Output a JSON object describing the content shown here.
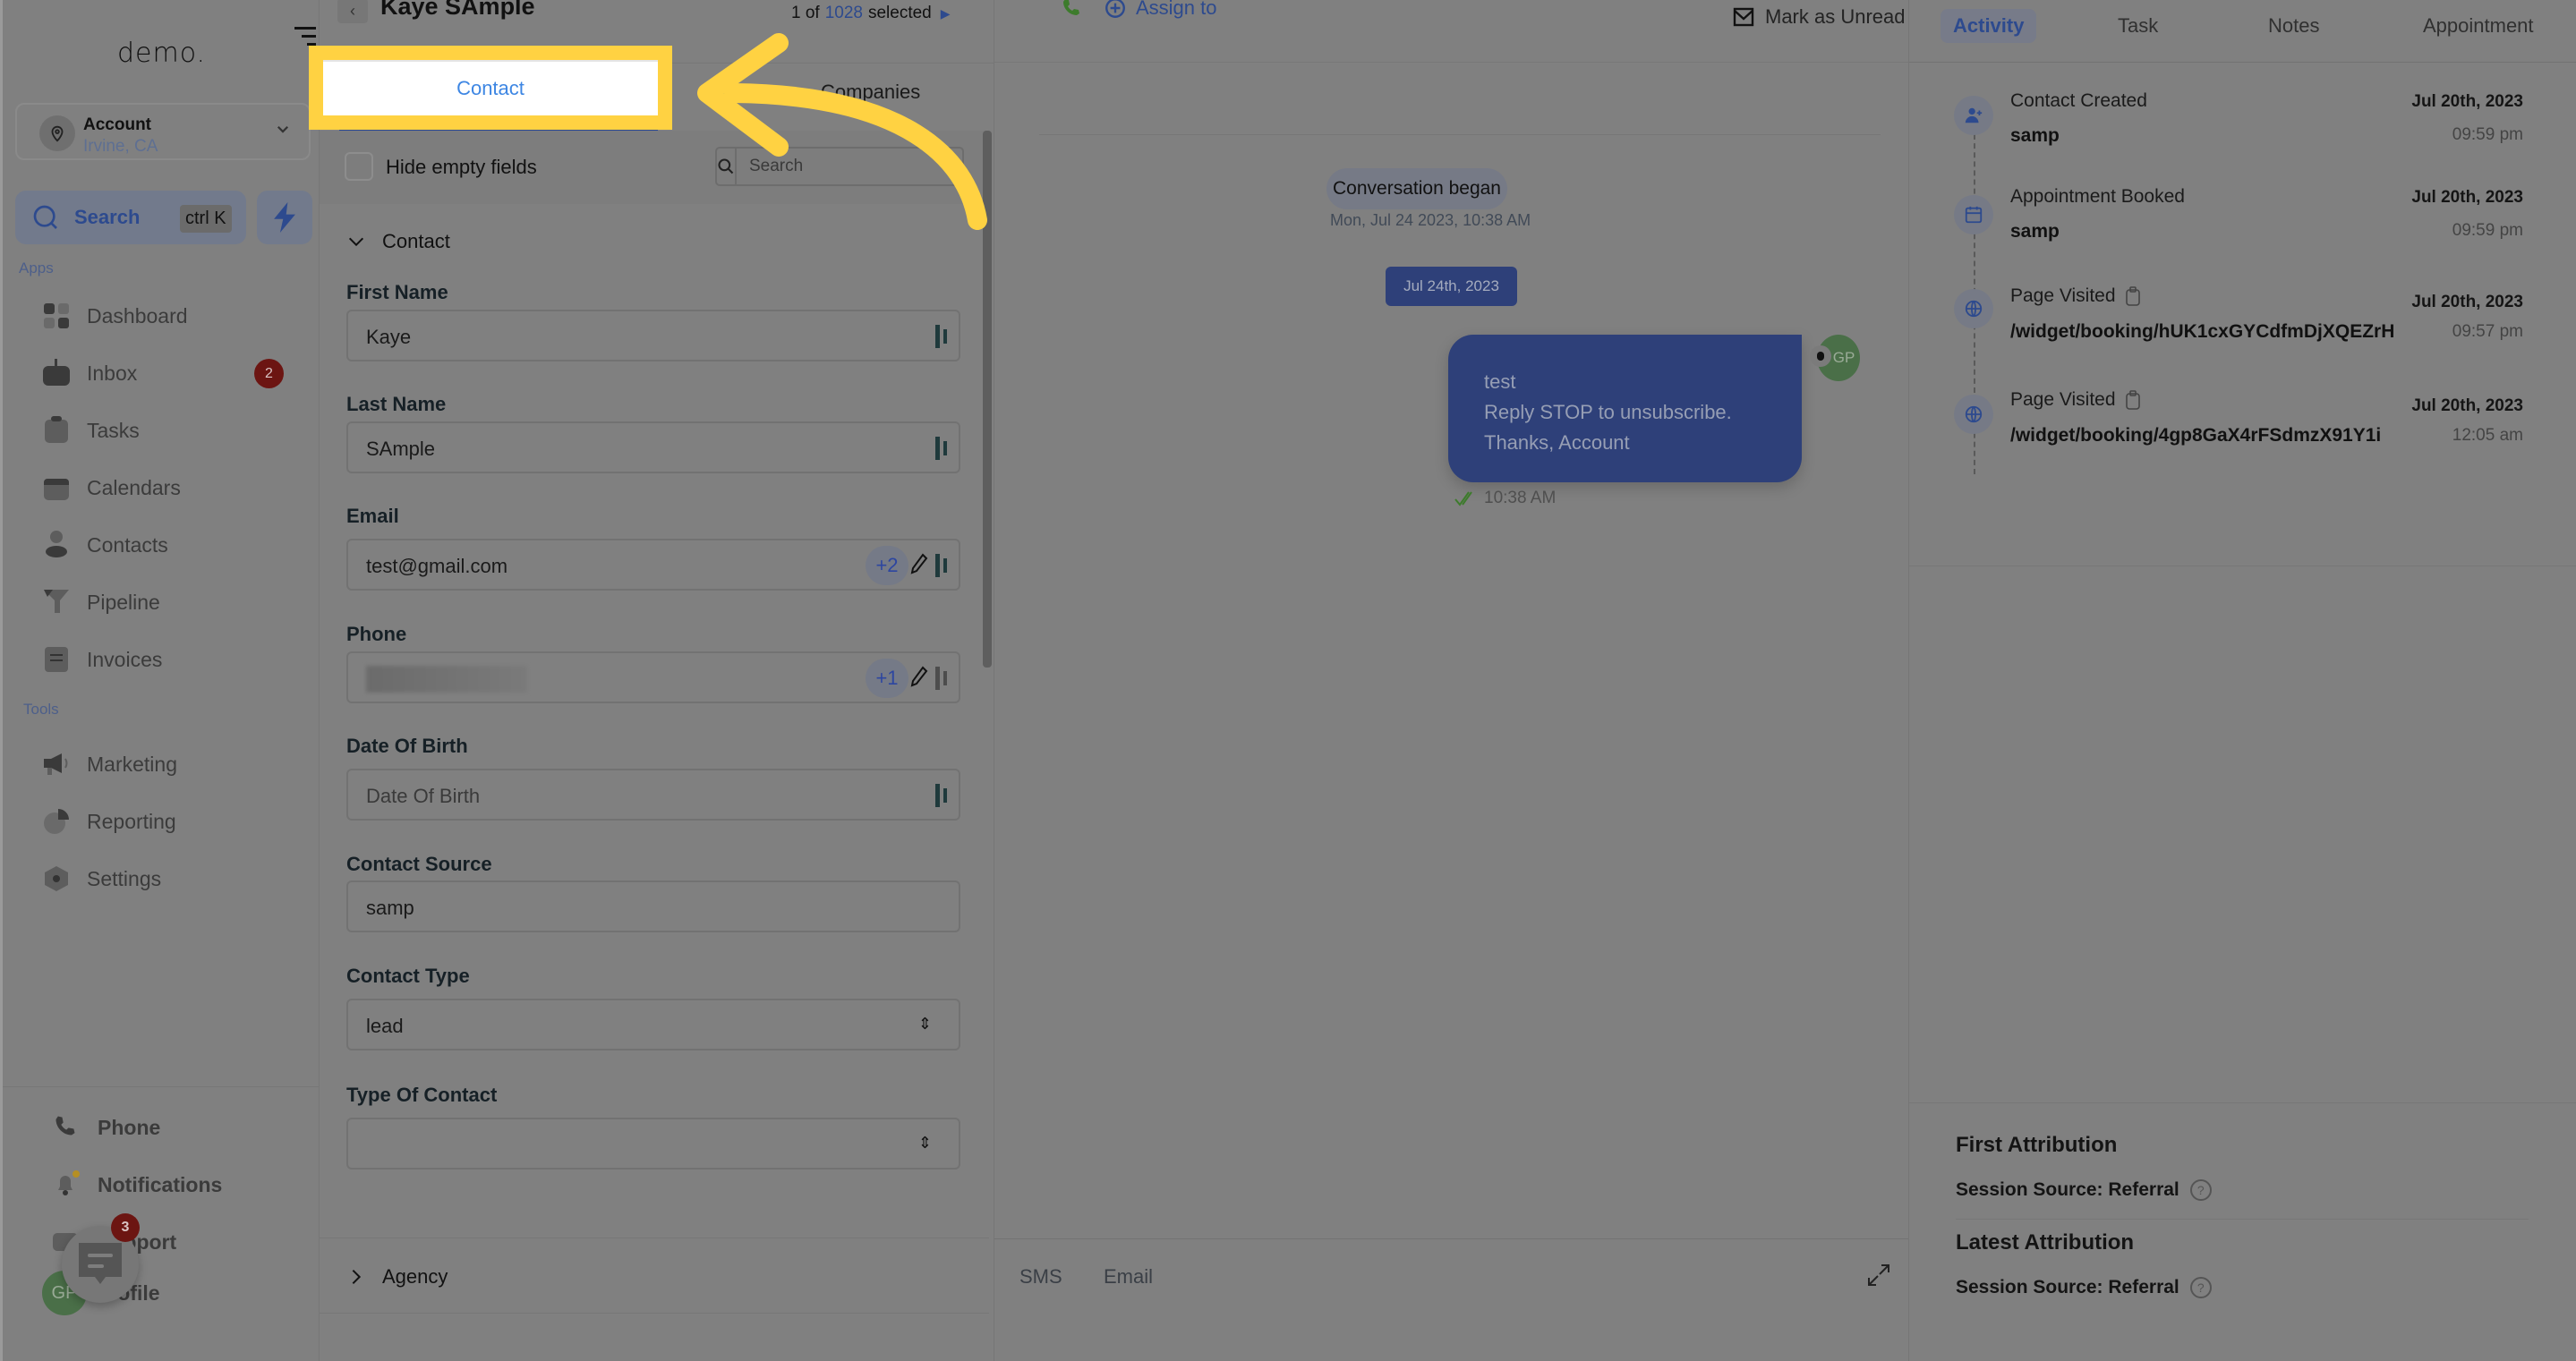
{
  "sidebar": {
    "logo": "demo.",
    "account": {
      "name": "Account",
      "location": "Irvine, CA"
    },
    "search": {
      "label": "Search",
      "shortcut": "ctrl K"
    },
    "apps_label": "Apps",
    "tools_label": "Tools",
    "apps": [
      {
        "label": "Dashboard",
        "icon": "dashboard-icon"
      },
      {
        "label": "Inbox",
        "icon": "inbox-icon",
        "badge": "2"
      },
      {
        "label": "Tasks",
        "icon": "tasks-icon"
      },
      {
        "label": "Calendars",
        "icon": "calendar-icon"
      },
      {
        "label": "Contacts",
        "icon": "contacts-icon"
      },
      {
        "label": "Pipeline",
        "icon": "pipeline-icon"
      },
      {
        "label": "Invoices",
        "icon": "invoice-icon"
      }
    ],
    "tools": [
      {
        "label": "Marketing",
        "icon": "megaphone-icon"
      },
      {
        "label": "Reporting",
        "icon": "pie-chart-icon"
      },
      {
        "label": "Settings",
        "icon": "settings-icon"
      }
    ],
    "bottom": [
      {
        "label": "Phone",
        "icon": "phone-icon"
      },
      {
        "label": "Notifications",
        "icon": "bell-icon"
      },
      {
        "label": "Support",
        "icon": "support-icon"
      },
      {
        "label": "Profile",
        "icon": "avatar",
        "initials": "GP"
      }
    ],
    "chat_widget_badge": "3"
  },
  "contact_panel": {
    "name": "Kaye SAmple",
    "pager": {
      "current": "1 of",
      "total": "1028",
      "suffix": "selected"
    },
    "tabs": [
      {
        "label": "Contact",
        "active": true
      },
      {
        "label": "Companies",
        "active": false
      }
    ],
    "hide_empty_label": "Hide empty fields",
    "search_placeholder": "Search",
    "section_contact": "Contact",
    "section_agency": "Agency",
    "fields": {
      "first_name": {
        "label": "First Name",
        "value": "Kaye"
      },
      "last_name": {
        "label": "Last Name",
        "value": "SAmple"
      },
      "email": {
        "label": "Email",
        "value": "test@gmail.com",
        "extra": "+2"
      },
      "phone": {
        "label": "Phone",
        "value": "",
        "extra": "+1"
      },
      "dob": {
        "label": "Date Of Birth",
        "placeholder": "Date Of Birth"
      },
      "contact_source": {
        "label": "Contact Source",
        "value": "samp"
      },
      "contact_type": {
        "label": "Contact Type",
        "value": "lead"
      },
      "type_of_contact": {
        "label": "Type Of Contact",
        "value": ""
      }
    }
  },
  "conversation": {
    "assign_label": "Assign to",
    "mark_unread_label": "Mark as Unread",
    "began_label": "Conversation began",
    "began_time": "Mon, Jul 24 2023, 10:38 AM",
    "date_divider": "Jul 24th, 2023",
    "message": {
      "lines": [
        "test",
        "Reply STOP to unsubscribe.",
        "Thanks, Account"
      ],
      "time": "10:38 AM",
      "avatar": "GP"
    },
    "compose_tabs": [
      "SMS",
      "Email"
    ]
  },
  "right_panel": {
    "tabs": [
      {
        "label": "Activity",
        "active": true
      },
      {
        "label": "Task",
        "active": false
      },
      {
        "label": "Notes",
        "active": false
      },
      {
        "label": "Appointment",
        "active": false
      }
    ],
    "activities": [
      {
        "title": "Contact Created",
        "sub": "samp",
        "date": "Jul 20th, 2023",
        "time": "09:59 pm",
        "icon": "user-plus-icon"
      },
      {
        "title": "Appointment Booked",
        "sub": "samp",
        "date": "Jul 20th, 2023",
        "time": "09:59 pm",
        "icon": "calendar-icon"
      },
      {
        "title": "Page Visited",
        "sub": "/widget/booking/hUK1cxGYCdfmDjXQEZrH",
        "date": "Jul 20th, 2023",
        "time": "09:57 pm",
        "icon": "globe-icon"
      },
      {
        "title": "Page Visited",
        "sub": "/widget/booking/4gp8GaX4rFSdmzX91Y1i",
        "date": "Jul 20th, 2023",
        "time": "12:05 am",
        "icon": "globe-icon"
      }
    ],
    "first_attribution": {
      "title": "First Attribution",
      "row": "Session Source: Referral"
    },
    "latest_attribution": {
      "title": "Latest Attribution",
      "row": "Session Source: Referral"
    }
  },
  "highlight": {
    "color": "#ffd242",
    "target": "Contact"
  }
}
